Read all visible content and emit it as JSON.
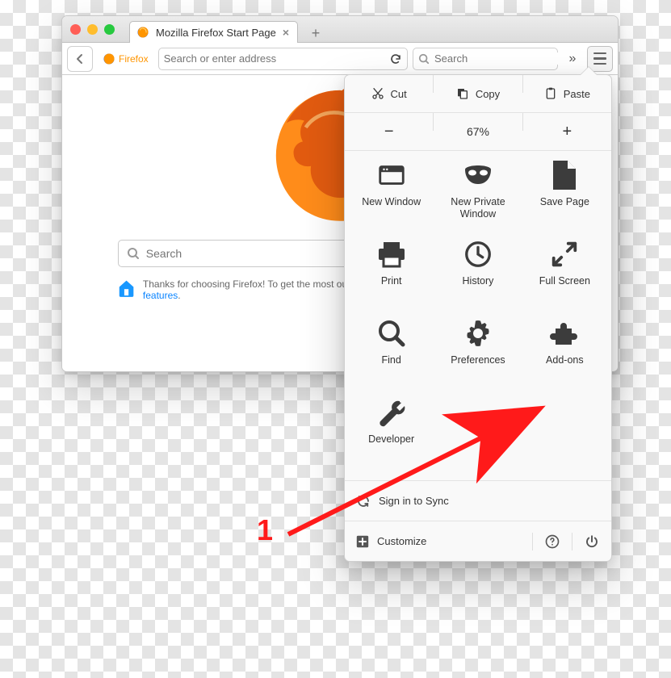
{
  "window": {
    "tab_title": "Mozilla Firefox Start Page",
    "identity_label": "Firefox",
    "url_placeholder": "Search or enter address",
    "toolbar_search_placeholder": "Search"
  },
  "home": {
    "search_placeholder": "Search",
    "thanks_prefix": "Thanks for choosing Firefox! To get the most out of your browser, learn more about the ",
    "thanks_link": "latest features"
  },
  "menu": {
    "cut": "Cut",
    "copy": "Copy",
    "paste": "Paste",
    "zoom": "67%",
    "items": [
      {
        "label": "New Window"
      },
      {
        "label": "New Private Window"
      },
      {
        "label": "Save Page"
      },
      {
        "label": "Print"
      },
      {
        "label": "History"
      },
      {
        "label": "Full Screen"
      },
      {
        "label": "Find"
      },
      {
        "label": "Preferences"
      },
      {
        "label": "Add-ons"
      },
      {
        "label": "Developer"
      }
    ],
    "sync": "Sign in to Sync",
    "customize": "Customize"
  },
  "annotation": {
    "step": "1"
  }
}
